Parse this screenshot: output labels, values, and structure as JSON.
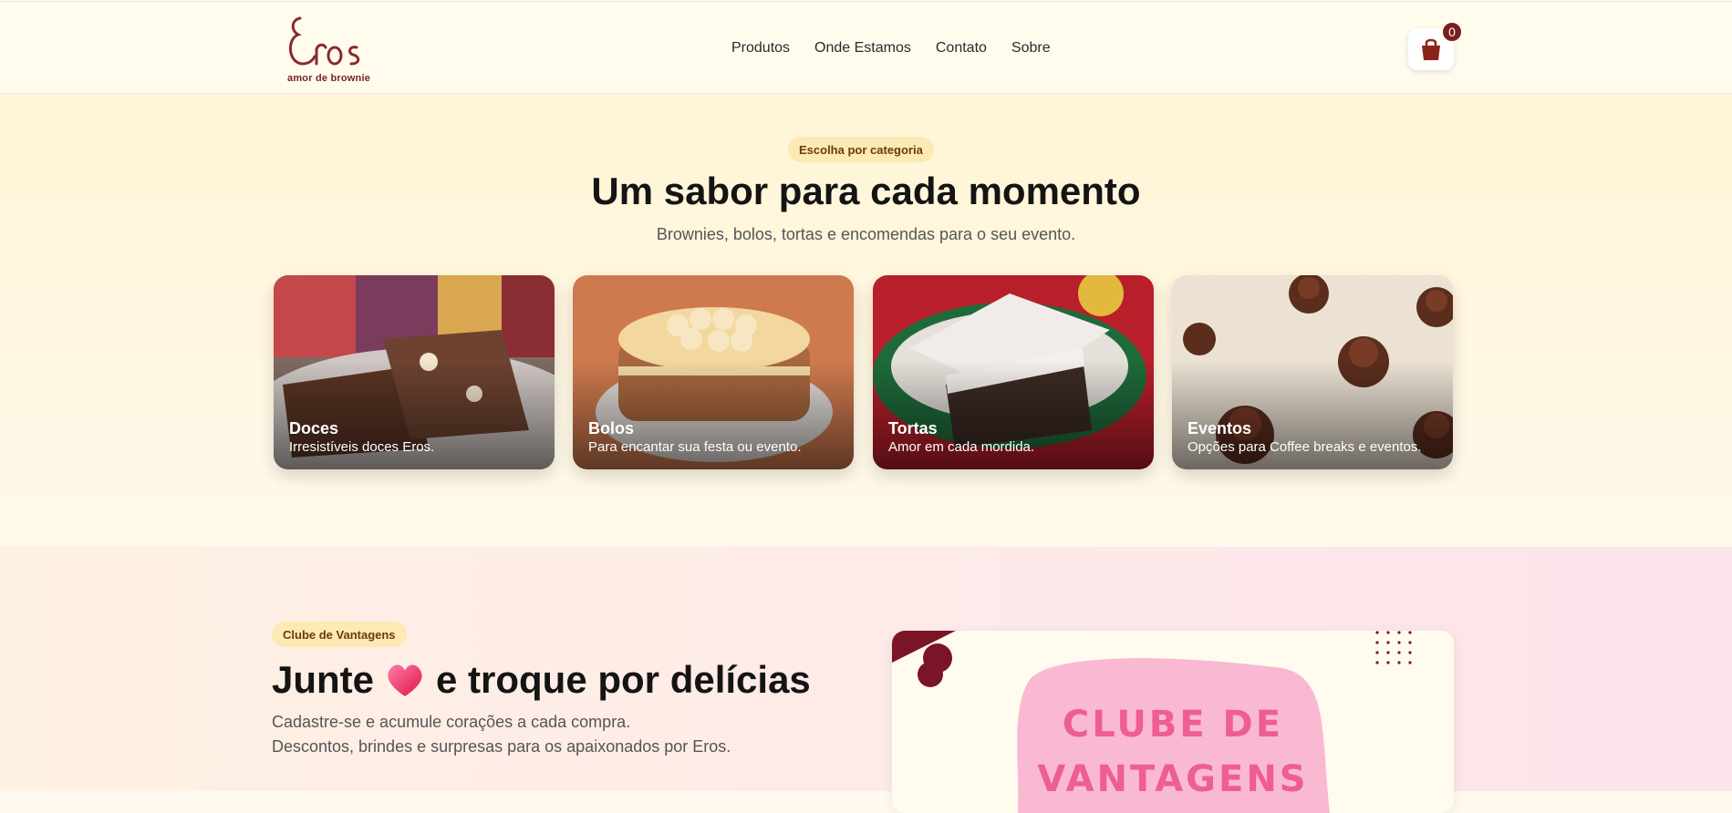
{
  "brand": {
    "name": "Eros",
    "tagline": "amor de brownie"
  },
  "nav": {
    "items": [
      {
        "label": "Produtos"
      },
      {
        "label": "Onde Estamos"
      },
      {
        "label": "Contato"
      },
      {
        "label": "Sobre"
      }
    ]
  },
  "cart": {
    "icon": "shopping-bag-icon",
    "count": "0"
  },
  "categories": {
    "badge": "Escolha por categoria",
    "title": "Um sabor para cada momento",
    "subtitle": "Brownies, bolos, tortas e encomendas para o seu evento.",
    "cards": [
      {
        "title": "Doces",
        "description": "Irresistíveis doces Eros."
      },
      {
        "title": "Bolos",
        "description": "Para encantar sua festa ou evento."
      },
      {
        "title": "Tortas",
        "description": "Amor em cada mordida."
      },
      {
        "title": "Eventos",
        "description": "Opções para Coffee breaks e eventos."
      }
    ]
  },
  "club": {
    "badge": "Clube de Vantagens",
    "title_before": "Junte",
    "title_icon": "heart-icon",
    "title_after": "e troque por delícias",
    "line1": "Cadastre-se e acumule corações a cada compra.",
    "line2": "Descontos, brindes e surpresas para os apaixonados por Eros.",
    "card_text_line1": "CLUBE DE",
    "card_text_line2": "VANTAGENS"
  },
  "colors": {
    "brand": "#7a1e1e",
    "pill_bg": "#fde9b3",
    "club_pink": "#f8b8cf"
  }
}
